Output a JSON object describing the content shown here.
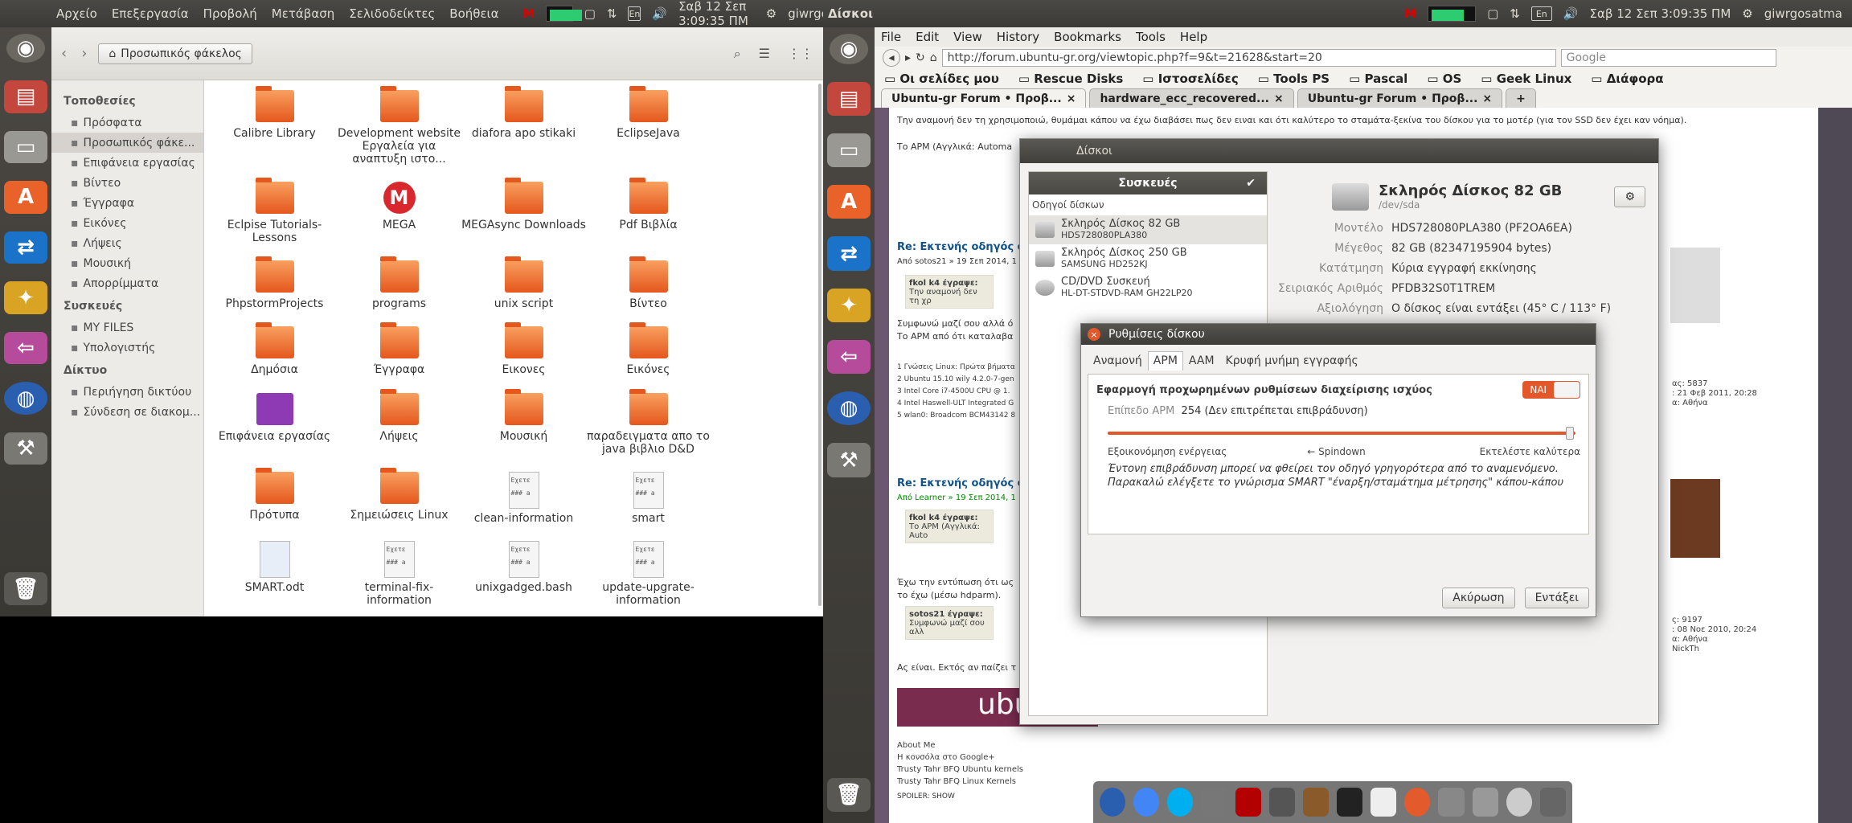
{
  "left_panel": {
    "menu": [
      "Αρχείο",
      "Επεξεργασία",
      "Προβολή",
      "Μετάβαση",
      "Σελιδοδείκτες",
      "Βοήθεια"
    ],
    "clock": "Σαβ 12 Σεπ  3:09:35 ΠΜ",
    "user": "giwrgosatma",
    "keyboard": "En"
  },
  "right_panel": {
    "title": "Δίσκοι",
    "clock": "Σαβ 12 Σεπ  3:09:35 ΠΜ",
    "user": "giwrgosatma",
    "keyboard": "En"
  },
  "nautilus": {
    "path_label": "Προσωπικός φάκελος",
    "sidebar_sections": [
      {
        "title": "Τοποθεσίες",
        "items": [
          "Πρόσφατα",
          "Προσωπικός φάκε...",
          "Επιφάνεια εργασίας",
          "Βίντεο",
          "Έγγραφα",
          "Εικόνες",
          "Λήψεις",
          "Μουσική",
          "Απορρίμματα"
        ]
      },
      {
        "title": "Συσκευές",
        "items": [
          "MY FILES",
          "Υπολογιστής"
        ]
      },
      {
        "title": "Δίκτυο",
        "items": [
          "Περιήγηση δικτύου",
          "Σύνδεση σε διακομ..."
        ]
      }
    ],
    "files": [
      {
        "name": "Calibre Library",
        "type": "folder"
      },
      {
        "name": "Development website Εργαλεία για αναπτυξη ιστο...",
        "type": "folder"
      },
      {
        "name": "diafora apo stikaki",
        "type": "folder"
      },
      {
        "name": "EclipseJava",
        "type": "folder"
      },
      {
        "name": "Eclpise Tutorials-Lessons",
        "type": "folder"
      },
      {
        "name": "MEGA",
        "type": "mega"
      },
      {
        "name": "MEGAsync Downloads",
        "type": "folder"
      },
      {
        "name": "Pdf Βιβλία",
        "type": "folder"
      },
      {
        "name": "PhpstormProjects",
        "type": "folder"
      },
      {
        "name": "programs",
        "type": "folder"
      },
      {
        "name": "unix script",
        "type": "folder"
      },
      {
        "name": "Βίντεο",
        "type": "folder"
      },
      {
        "name": "Δημόσια",
        "type": "folder"
      },
      {
        "name": "Έγγραφα",
        "type": "folder"
      },
      {
        "name": "Εικονες",
        "type": "folder"
      },
      {
        "name": "Εικόνες",
        "type": "folder"
      },
      {
        "name": "Επιφάνεια εργασίας",
        "type": "desktop"
      },
      {
        "name": "Λήψεις",
        "type": "folder"
      },
      {
        "name": "Μουσική",
        "type": "folder"
      },
      {
        "name": "παραδειγματα απο το java βιβλιο D&D",
        "type": "folder"
      },
      {
        "name": "Πρότυπα",
        "type": "folder"
      },
      {
        "name": "Σημειώσεις Linux",
        "type": "folder"
      },
      {
        "name": "clean-information",
        "type": "script"
      },
      {
        "name": "smart",
        "type": "script"
      },
      {
        "name": "SMART.odt",
        "type": "odt"
      },
      {
        "name": "terminal-fix-information",
        "type": "script"
      },
      {
        "name": "unixgadged.bash",
        "type": "script"
      },
      {
        "name": "update-upgrate-information",
        "type": "script"
      }
    ]
  },
  "firefox": {
    "menu": [
      "File",
      "Edit",
      "View",
      "History",
      "Bookmarks",
      "Tools",
      "Help"
    ],
    "url": "http://forum.ubuntu-gr.org/viewtopic.php?f=9&t=21628&start=20",
    "search_placeholder": "Google",
    "bookmarks": [
      "Οι σελίδες μου",
      "Rescue Disks",
      "Ιστοσελίδες",
      "Tools PS",
      "Pascal",
      "OS",
      "Geek Linux",
      "Διάφορα"
    ],
    "tabs": [
      "Ubuntu-gr Forum • Προβ...",
      "hardware_ecc_recovered...",
      "Ubuntu-gr Forum • Προβ..."
    ],
    "post_text_1": "Την αναμονή δεν τη χρησιμοποιώ, θυμάμαι κάπου να έχω διαβάσει πως δεν ειναι και ότι καλύτερο το σταμάτα-ξεκίνα του δίσκου για το μοτέρ (για τον SSD δεν έχει καν νόημα).",
    "post_text_2": "Το APM (Αγγλικά: Automa",
    "re_title_1": "Re: Εκτενής οδηγός σ",
    "re_by_1": "Από sotos21 » 19 Σεπ 2014, 1",
    "quote_1_head": "fkol k4 έγραψε:",
    "quote_1_text": "Την αναμονή δεν τη χρ",
    "agree_text": "Συμφωνώ μαζί σου αλλά ό",
    "apm_text": "Το APM από ότι καταλαβα",
    "specs": [
      "1 Γνώσεις Linux: Πρώτα βήματα",
      "2 Ubuntu 15.10 wily 4.2.0-7-gen",
      "3 Intel Core i7-4500U CPU @ 1.",
      "4 Intel Haswell-ULT Integrated G",
      "5 wlan0: Broadcom BCM43142 8"
    ],
    "re_title_2": "Re: Εκτενής οδηγός σ",
    "re_by_2": "Από Learner » 19 Σεπ 2014, 1",
    "quote_2_head": "fkol k4 έγραψε:",
    "quote_2_text": "Το APM (Αγγλικά: Auto",
    "print_text": "Έχω την εντύπωση ότι ως",
    "hdparm_text": "το έχω (μέσω hdparm).",
    "quote_3_head": "sotos21 έγραψε:",
    "quote_3_text": "Συμφωνώ μαζί σου αλλ",
    "end_text": "Ας είναι. Εκτός αν παίζει τ",
    "links": [
      "About Me",
      "Η κονσόλα στο Google+",
      "Trusty Tahr BFQ Ubuntu kernels",
      "Trusty Tahr BFQ Linux Kernels"
    ],
    "spoiler": "SPOILER: SHOW",
    "user_stats_1": [
      "ας: 5837",
      ": 21 Φεβ 2011, 20:28",
      "α: Αθήνα"
    ],
    "user_stats_2": [
      "ς: 9197",
      ": 08 Νοε 2010, 20:24",
      "α: Αθήνα",
      "NickTh"
    ]
  },
  "disks": {
    "title": "Δίσκοι",
    "devices_header": "Συσκευές",
    "section": "Οδηγοί δίσκων",
    "drives": [
      {
        "name": "Σκληρός Δίσκος 82 GB",
        "model": "HDS728080PLA380"
      },
      {
        "name": "Σκληρός Δίσκος 250 GB",
        "model": "SAMSUNG HD252KJ"
      },
      {
        "name": "CD/DVD Συσκευή",
        "model": "HL-DT-STDVD-RAM GH22LP20"
      }
    ],
    "main_title": "Σκληρός Δίσκος 82 GB",
    "main_dev": "/dev/sda",
    "props": [
      {
        "k": "Μοντέλο",
        "v": "HDS728080PLA380 (PF2OA6EA)"
      },
      {
        "k": "Μέγεθος",
        "v": "82 GB (82347195904 bytes)"
      },
      {
        "k": "Κατάτμηση",
        "v": "Κύρια εγγραφή εκκίνησης"
      },
      {
        "k": "Σειριακός Αριθμός",
        "v": "PFDB32S0T1TREM"
      },
      {
        "k": "Αξιολόγηση",
        "v": "Ο δίσκος είναι εντάξει (45° C / 113° F)"
      }
    ]
  },
  "dialog": {
    "title": "Ρυθμίσεις δίσκου",
    "tabs": [
      "Αναμονή",
      "APM",
      "AAM",
      "Κρυφή μνήμη εγγραφής"
    ],
    "active_tab": "APM",
    "apply_label": "Εφαρμογή προχωρημένων ρυθμίσεων διαχείρισης ισχύος",
    "toggle": "ΝΑΙ",
    "level_label": "Επίπεδο APM",
    "level_value": "254 (Δεν επιτρέπεται επιβράδυνση)",
    "level_fraction": 0.996,
    "scale_left": "Εξοικονόμηση ενέργειας",
    "scale_mid": "← Spindown",
    "scale_right": "Εκτελέστε καλύτερα",
    "warning_1": "Έντονη επιβράδυνση μπορεί να φθείρει τον οδηγό γρηγορότερα από το αναμενόμενο.",
    "warning_2": "Παρακαλώ ελέγξετε το γνώρισμα SMART \"έναρξη/σταμάτημα μέτρησης\" κάπου-κάπου",
    "cancel": "Ακύρωση",
    "ok": "Εντάξει"
  }
}
